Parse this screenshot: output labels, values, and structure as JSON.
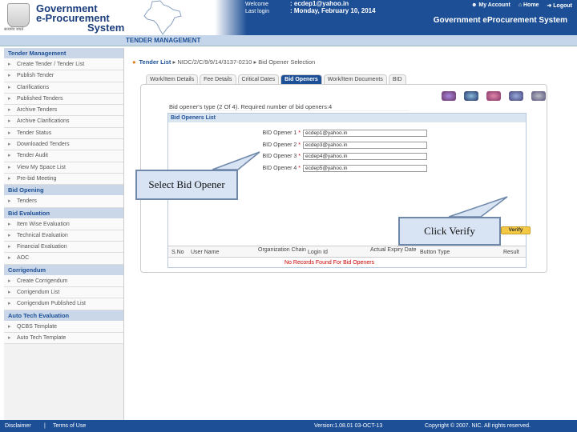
{
  "header": {
    "logo_line1": "Government",
    "logo_line2": "e-Procurement",
    "logo_line3": "System",
    "emblem_text": "सत्यमेव जयते",
    "welcome_label": "Welcome",
    "last_login_label": "Last login",
    "welcome_value": ": ecdep1@yahoo.in",
    "last_login_value": ": Monday, February 10, 2014",
    "my_account": "My Account",
    "home": "Home",
    "logout": "Logout",
    "system_title": "Government eProcurement System"
  },
  "navbar": {
    "title": "TENDER MANAGEMENT"
  },
  "sidebar": {
    "sections": [
      {
        "title": "Tender Management",
        "items": [
          "Create Tender / Tender List",
          "Publish Tender",
          "Clarifications",
          "Published Tenders",
          "Archive Tenders",
          "Archive Clarifications",
          "Tender Status",
          "Downloaded Tenders",
          "Tender Audit",
          "View My Space List",
          "Pre-bid Meeting"
        ]
      },
      {
        "title": "Bid Opening",
        "items": [
          "Tenders"
        ]
      },
      {
        "title": "Bid Evaluation",
        "items": [
          "Item Wise Evaluation",
          "Technical Evaluation",
          "Financial Evaluation",
          "AOC"
        ]
      },
      {
        "title": "Corrigendum",
        "items": [
          "Create Corrigendum",
          "Corrigendum List",
          "Corrigendum Published List"
        ]
      },
      {
        "title": "Auto Tech Evaluation",
        "items": [
          "QCBS Template",
          "Auto Tech Template"
        ]
      }
    ]
  },
  "breadcrumb": {
    "root": "Tender List",
    "ref": "NIDC/2/C/9/9/14/3137-0210",
    "current": "Bid Opener Selection"
  },
  "tabs": [
    "Work/Item Details",
    "Fee Details",
    "Critical Dates",
    "Bid Openers",
    "Work/Item Documents",
    "BID"
  ],
  "active_tab": "Bid Openers",
  "panel": {
    "type_line": "Bid opener's type (2 Of 4). Required number of bid openers:4",
    "list_title": "Bid Openers List",
    "openers": [
      {
        "label": "BID Opener 1",
        "value": "ecdep1@yahoo.in"
      },
      {
        "label": "BID Opener 2",
        "value": "ecdep3@yahoo.in"
      },
      {
        "label": "BID Opener 3",
        "value": "ecdep4@yahoo.in"
      },
      {
        "label": "BID Opener 4",
        "value": "ecdep5@yahoo.in"
      }
    ],
    "required_mark": "*",
    "verify_label": "Verify",
    "table_headers": [
      "S.No",
      "User Name",
      "Organization Chain",
      "Login Id",
      "Actual Expiry Date",
      "Button Type",
      "Result"
    ],
    "no_record": "No Records Found For Bid Openers"
  },
  "callouts": {
    "select": "Select Bid Opener",
    "verify": "Click Verify"
  },
  "footer": {
    "disclaimer": "Disclaimer",
    "terms": "Terms of Use",
    "version": "Version:1.08.01 03-OCT-13",
    "copyright": "Copyright ©  2007. NIC. All rights reserved."
  }
}
